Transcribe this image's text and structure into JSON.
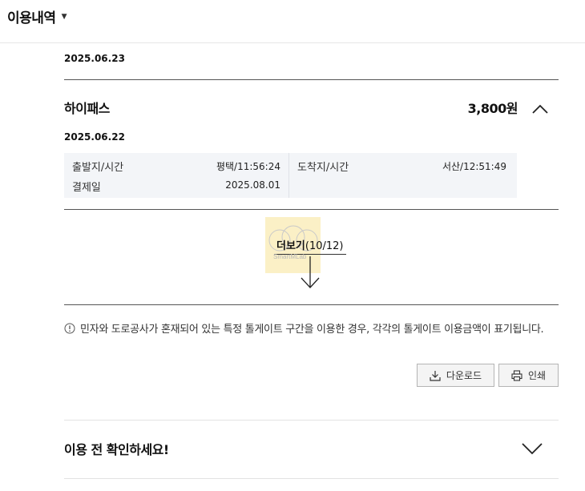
{
  "header": {
    "title": "이용내역",
    "dropdown_icon": "caret-down-icon"
  },
  "list": {
    "previous_date": "2025.06.23",
    "item": {
      "service_name": "하이패스",
      "amount": "3,800원",
      "toggle_icon": "chevron-up-icon",
      "date": "2025.06.22",
      "details": {
        "departure_label": "출발지/시간",
        "departure_value": "평택/11:56:24",
        "payment_label": "결제일",
        "payment_value": "2025.08.01",
        "arrival_label": "도착지/시간",
        "arrival_value": "서산/12:51:49"
      }
    },
    "more": {
      "label": "더보기",
      "count": "(10/12)",
      "watermark": "SmartMLab",
      "arrow_icon": "arrow-down-icon"
    }
  },
  "notice": {
    "icon": "info-icon",
    "text": "민자와 도로공사가 혼재되어 있는 특정 톨게이트 구간을 이용한 경우, 각각의 톨게이트 이용금액이 표기됩니다."
  },
  "actions": {
    "download_label": "다운로드",
    "download_icon": "download-icon",
    "print_label": "인쇄",
    "print_icon": "printer-icon"
  },
  "accordion": {
    "title": "이용 전 확인하세요!",
    "toggle_icon": "chevron-down-icon"
  },
  "colors": {
    "highlight": "#fbf0c6",
    "detail_bg": "#f3f5f8",
    "divider": "#555555",
    "button_bg": "#f4f4f4"
  }
}
